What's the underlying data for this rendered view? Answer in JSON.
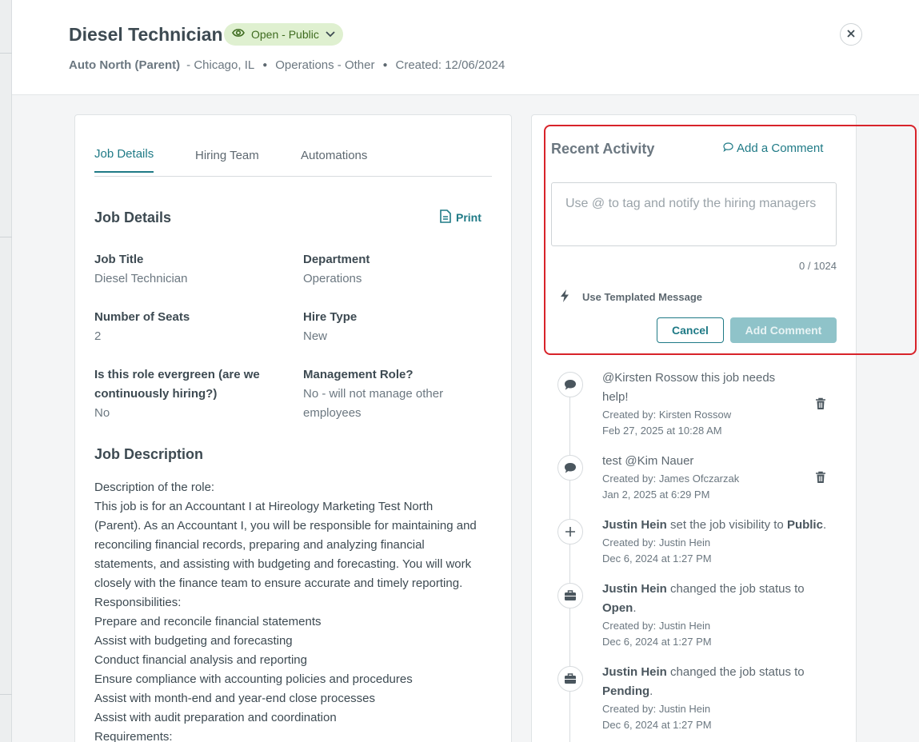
{
  "header": {
    "title": "Diesel Technician",
    "status": "Open - Public",
    "company": "Auto North (Parent)",
    "location": "- Chicago, IL",
    "department": "Operations - Other",
    "created": "Created: 12/06/2024"
  },
  "tabs": [
    {
      "label": "Job Details",
      "active": true
    },
    {
      "label": "Hiring Team",
      "active": false
    },
    {
      "label": "Automations",
      "active": false
    }
  ],
  "job_details": {
    "heading": "Job Details",
    "print_label": "Print",
    "fields": {
      "job_title_label": "Job Title",
      "job_title_value": "Diesel Technician",
      "department_label": "Department",
      "department_value": "Operations",
      "seats_label": "Number of Seats",
      "seats_value": "2",
      "hire_type_label": "Hire Type",
      "hire_type_value": "New",
      "evergreen_label_1": "Is this role evergreen (are we",
      "evergreen_label_2": "continuously hiring?)",
      "evergreen_value": "No",
      "mgmt_label": "Management Role?",
      "mgmt_value_1": "No - will not manage other",
      "mgmt_value_2": "employees"
    },
    "description_heading": "Job Description",
    "description_lines": [
      "Description of the role:",
      "This job is for an Accountant I at Hireology Marketing Test North",
      "(Parent). As an Accountant I, you will be responsible for maintaining and",
      "reconciling financial records, preparing and analyzing financial",
      "statements, and assisting with budgeting and forecasting. You will work",
      "closely with the finance team to ensure accurate and timely reporting.",
      "Responsibilities:",
      "Prepare and reconcile financial statements",
      "Assist with budgeting and forecasting",
      "Conduct financial analysis and reporting",
      "Ensure compliance with accounting policies and procedures",
      "Assist with month-end and year-end close processes",
      "Assist with audit preparation and coordination",
      "Requirements:"
    ]
  },
  "activity": {
    "title": "Recent Activity",
    "add_comment_link": "Add a Comment",
    "placeholder": "Use @ to tag and notify the hiring managers",
    "counter": "0 / 1024",
    "templated": "Use Templated Message",
    "cancel": "Cancel",
    "add_comment_btn": "Add Comment",
    "items": [
      {
        "icon": "comment-icon",
        "line1": "@Kirsten Rossow this job needs",
        "line2": "help!",
        "by": "Created by: Kirsten Rossow",
        "date": "Feb 27, 2025 at 10:28 AM"
      },
      {
        "icon": "comment-icon",
        "line1": "test @Kim Nauer",
        "by": "Created by: James Ofczarzak",
        "date": "Jan 2, 2025 at 6:29 PM"
      },
      {
        "icon": "plus-icon",
        "actor": "Justin Hein",
        "action": " set the job visibility to ",
        "target": "Public",
        "suffix": ".",
        "by": "Created by: Justin Hein",
        "date": "Dec 6, 2024 at 1:27 PM"
      },
      {
        "icon": "briefcase-icon",
        "actor": "Justin Hein",
        "action": " changed the job status to",
        "target": "Open",
        "suffix": ".",
        "by": "Created by: Justin Hein",
        "date": "Dec 6, 2024 at 1:27 PM"
      },
      {
        "icon": "briefcase-icon",
        "actor": "Justin Hein",
        "action": " changed the job status to",
        "target": "Pending",
        "suffix": ".",
        "by": "Created by: Justin Hein",
        "date": "Dec 6, 2024 at 1:27 PM"
      }
    ]
  },
  "colors": {
    "accent": "#1f7a86",
    "status_bg": "#dff0d0",
    "highlight": "#d8232a"
  }
}
